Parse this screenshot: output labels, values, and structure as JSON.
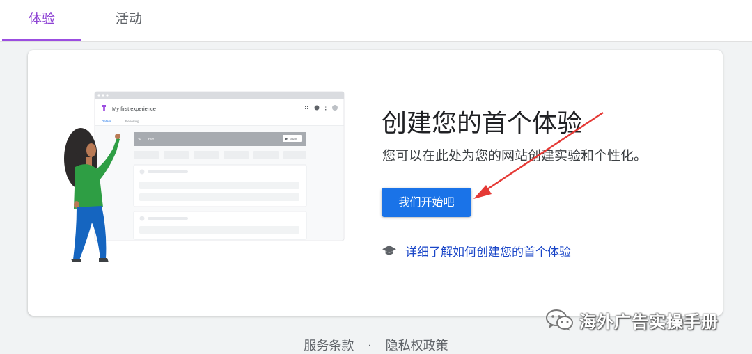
{
  "tabs": [
    {
      "label": "体验",
      "active": true
    },
    {
      "label": "活动",
      "active": false
    }
  ],
  "illustration": {
    "window_title": "My first experience",
    "tabs": [
      "Details",
      "Reporting"
    ],
    "status": "Draft",
    "start_label": "Start"
  },
  "main": {
    "title": "创建您的首个体验",
    "subtitle": "您可以在此处为您的网站创建实验和个性化。",
    "cta_label": "我们开始吧",
    "learn_link": "详细了解如何创建您的首个体验"
  },
  "footer": {
    "terms": "服务条款",
    "separator": "·",
    "privacy": "隐私权政策"
  },
  "watermark": {
    "text": "海外广告实操手册"
  },
  "colors": {
    "accent_purple": "#9b4de0",
    "primary_blue": "#1a73e8",
    "arrow_red": "#e53935"
  }
}
